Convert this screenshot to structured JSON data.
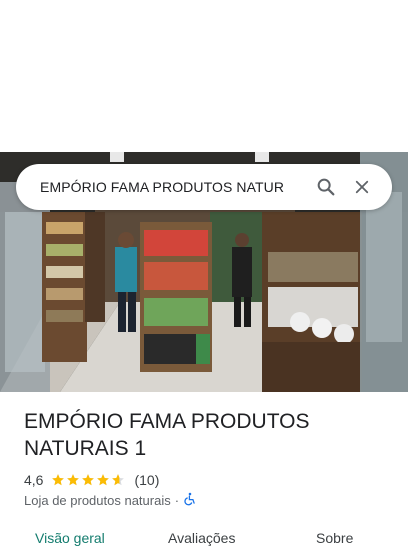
{
  "search": {
    "query": "EMPÓRIO FAMA PRODUTOS NATUR",
    "search_icon": "search-icon",
    "clear_icon": "close-icon"
  },
  "place": {
    "name": "EMPÓRIO FAMA PRODUTOS NATURAIS 1",
    "rating": "4,6",
    "stars": 4.6,
    "review_count": "(10)",
    "category": "Loja de produtos naturais",
    "separator": "·",
    "accessibility_icon": "wheelchair-icon"
  },
  "tabs": [
    {
      "label": "Visão geral",
      "active": true
    },
    {
      "label": "Avaliações",
      "active": false
    },
    {
      "label": "Sobre",
      "active": false
    }
  ],
  "colors": {
    "star": "#fbbc04",
    "accent_tab": "#137c6e",
    "accessibility": "#1a73e8"
  }
}
